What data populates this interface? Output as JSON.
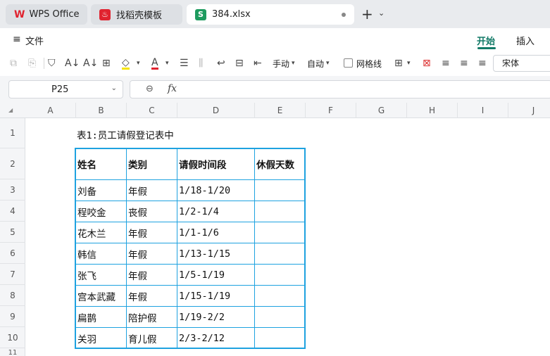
{
  "tabs": [
    {
      "label": "WPS Office",
      "icon": "wps-logo-icon"
    },
    {
      "label": "找稻壳模板",
      "icon": "docer-icon"
    },
    {
      "label": "384.xlsx",
      "icon": "spreadsheet-icon",
      "icon_letter": "S"
    }
  ],
  "menu": {
    "file_label": "文件",
    "start_label": "开始",
    "insert_label": "插入"
  },
  "toolbar": {
    "manual_label": "手动",
    "auto_label": "自动",
    "gridlines_label": "网格线",
    "gridlines_checked": false,
    "font_name": "宋体"
  },
  "formula_bar": {
    "cell_ref": "P25",
    "fx": "fx",
    "content": ""
  },
  "columns": [
    "A",
    "B",
    "C",
    "D",
    "E",
    "F",
    "G",
    "H",
    "I",
    "J"
  ],
  "rows": [
    "1",
    "2",
    "3",
    "4",
    "5",
    "6",
    "7",
    "8",
    "9",
    "10",
    "11"
  ],
  "sheet": {
    "title": "表1:员工请假登记表中",
    "headers": [
      "姓名",
      "类别",
      "请假时间段",
      "休假天数"
    ],
    "records": [
      [
        "刘备",
        "年假",
        "1/18-1/20",
        ""
      ],
      [
        "程咬金",
        "丧假",
        "1/2-1/4",
        ""
      ],
      [
        "花木兰",
        "年假",
        "1/1-1/6",
        ""
      ],
      [
        "韩信",
        "年假",
        "1/13-1/15",
        ""
      ],
      [
        "张飞",
        "年假",
        "1/5-1/19",
        ""
      ],
      [
        "宫本武藏",
        "年假",
        "1/15-1/19",
        ""
      ],
      [
        "扁鹊",
        "陪护假",
        "1/19-2/2",
        ""
      ],
      [
        "关羽",
        "育儿假",
        "2/3-2/12",
        ""
      ]
    ]
  },
  "colors": {
    "accent": "#127a67",
    "table_border": "#1ea2e0",
    "wps_red": "#e0232f",
    "sheet_green": "#1e9b5f"
  }
}
